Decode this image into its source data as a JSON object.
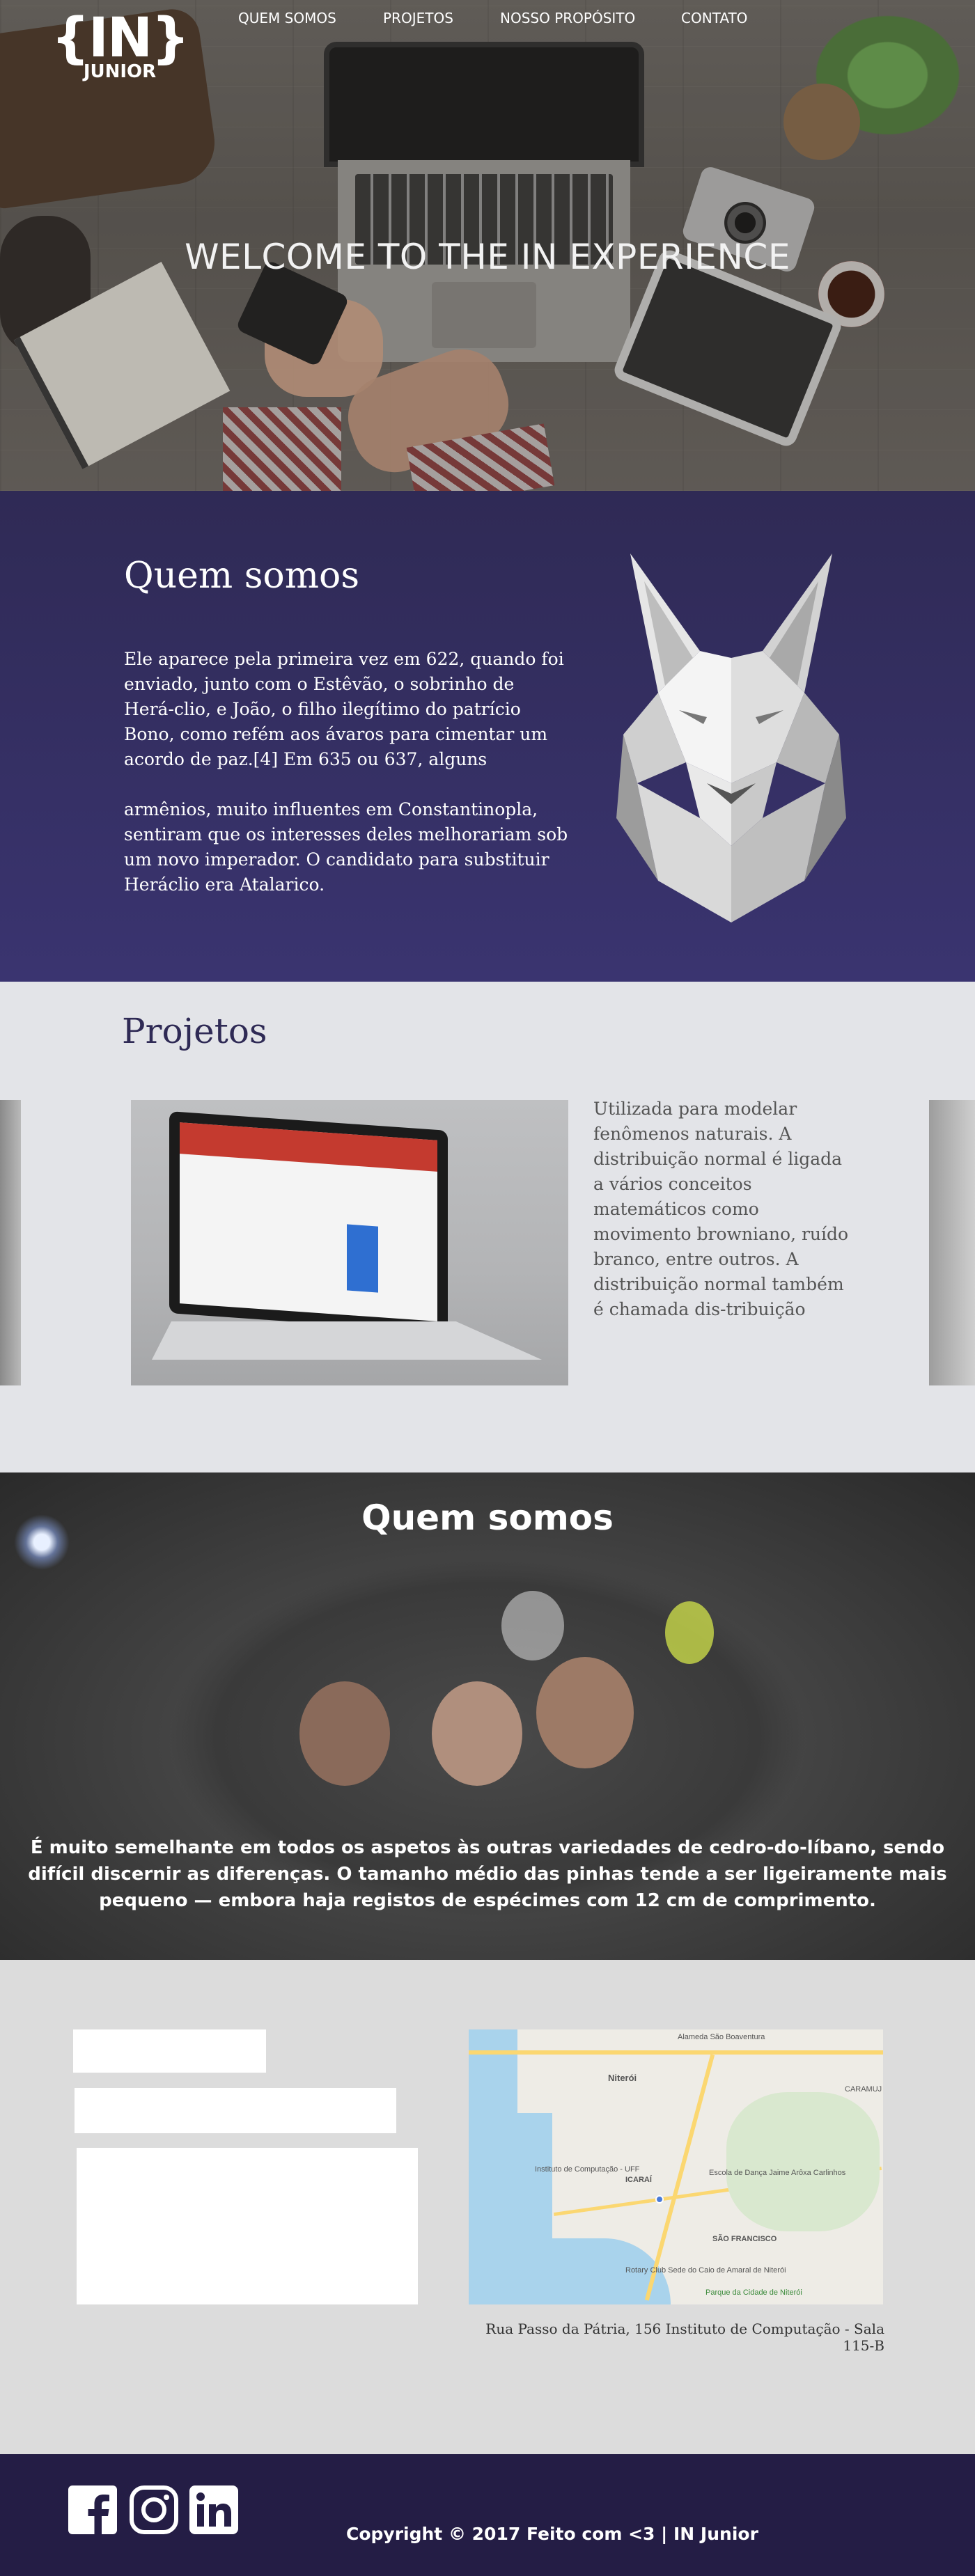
{
  "brand": {
    "logo_mark": "{IN}",
    "logo_word": "JUNIOR"
  },
  "nav": {
    "items": [
      {
        "label": "QUEM SOMOS"
      },
      {
        "label": "PROJETOS"
      },
      {
        "label": "NOSSO PROPÓSITO"
      },
      {
        "label": "CONTATO"
      }
    ]
  },
  "hero": {
    "title": "WELCOME TO THE IN EXPERIENCE"
  },
  "about": {
    "title": "Quem somos",
    "paragraphs": [
      "Ele aparece pela primeira vez em 622, quando foi enviado, junto com o Estêvão, o sobrinho de Herá-clio, e João, o filho ilegítimo do patrício Bono, como refém aos ávaros para cimentar um acordo de paz.[4] Em 635 ou 637, alguns",
      "armênios, muito influentes em Constantinopla, sentiram que os interesses deles melhorariam sob um novo imperador. O candidato para substituir Heráclio era Atalarico."
    ]
  },
  "projects": {
    "title": "Projetos",
    "description": "Utilizada para modelar fenômenos naturais. A distribuição normal é ligada a vários conceitos matemáticos como movimento browniano, ruído branco, entre outros. A distribuição normal também é chamada dis-tribuição"
  },
  "team": {
    "title": "Quem somos",
    "text": "É muito semelhante em todos os aspetos às outras variedades de cedro-do-líbano, sendo difícil discernir as diferenças. O tamanho médio das pinhas tende a ser ligeiramente mais pequeno — embora haja registos de espécimes com 12 cm de comprimento."
  },
  "contact": {
    "name_value": "",
    "email_value": "",
    "message_value": "",
    "address": "Rua Passo da Pátria, 156  Instituto de Computação - Sala 115-B",
    "map_labels": {
      "niteroi": "Niterói",
      "icarai": "ICARAÍ",
      "sao_francisco": "SÃO FRANCISCO",
      "caramujo": "CARAMUJ",
      "instituto": "Instituto de Computação - UFF",
      "escola": "Escola de Dança Jaime Arôxa Carlinhos",
      "parque": "Parque da Cidade de Niterói",
      "rotary": "Rotary Club Sede do Caio de Amaral de Niterói",
      "alameda": "Alameda São Boaventura"
    }
  },
  "footer": {
    "copyright": "Copyright © 2017 Feito com <3 | IN Junior",
    "social_icons": [
      "facebook-icon",
      "instagram-icon",
      "linkedin-icon"
    ]
  },
  "colors": {
    "purple_section": "#2f2a55",
    "footer_bg": "#241d45",
    "projects_bg": "#e3e4e8",
    "contact_bg": "#dcdcdc"
  }
}
